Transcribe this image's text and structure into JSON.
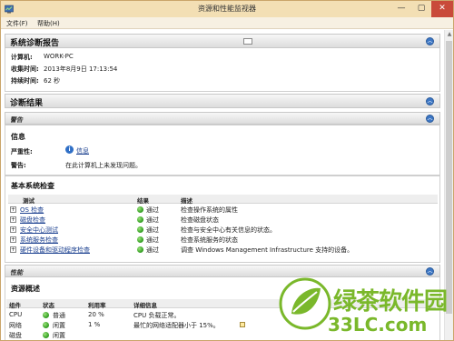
{
  "window": {
    "title": "资源和性能监视器",
    "controls": {
      "minimize": "—",
      "maximize": "▢",
      "close": "✕"
    }
  },
  "menu": {
    "file": "文件(F)",
    "help": "帮助(H)"
  },
  "report": {
    "title": "系统诊断报告",
    "computer_label": "计算机:",
    "computer_value": "WORK-PC",
    "collected_label": "收集时间:",
    "collected_value": "2013年8月9日 17:13:54",
    "duration_label": "持续时间:",
    "duration_value": "62 秒"
  },
  "results": {
    "title": "诊断结果",
    "warnings": "警告"
  },
  "info": {
    "title": "信息",
    "severity_label": "严重性:",
    "severity_value": "信息",
    "warning_label": "警告:",
    "warning_value": "在此计算机上未发现问题。"
  },
  "basic_checks": {
    "title": "基本系统检查",
    "headers": {
      "test": "测试",
      "result": "结果",
      "description": "描述"
    },
    "rows": [
      {
        "test": "OS 检查",
        "result": "通过",
        "description": "检查操作系统的属性"
      },
      {
        "test": "磁盘检查",
        "result": "通过",
        "description": "检查磁盘状态"
      },
      {
        "test": "安全中心测试",
        "result": "通过",
        "description": "检查与安全中心有关信息的状态。"
      },
      {
        "test": "系统服务检查",
        "result": "通过",
        "description": "检查系统服务的状态"
      },
      {
        "test": "硬件设备和驱动程序检查",
        "result": "通过",
        "description": "调查 Windows Management Infrastructure 支持的设备。"
      }
    ]
  },
  "performance": {
    "title": "性能"
  },
  "resources": {
    "title": "资源概述",
    "headers": {
      "component": "组件",
      "status": "状态",
      "usage": "利用率",
      "details": "详细信息"
    },
    "rows": [
      {
        "component": "CPU",
        "status": "普通",
        "usage": "20 %",
        "details": "CPU 负载正常。"
      },
      {
        "component": "网络",
        "status": "闲置",
        "usage": "1 %",
        "details": "最忙的网络适配器小于 15%。"
      },
      {
        "component": "磁盘",
        "status": "闲置",
        "usage": "",
        "details": ""
      }
    ]
  },
  "watermark": {
    "line1": "绿茶软件园",
    "line2": "33LC.com"
  }
}
